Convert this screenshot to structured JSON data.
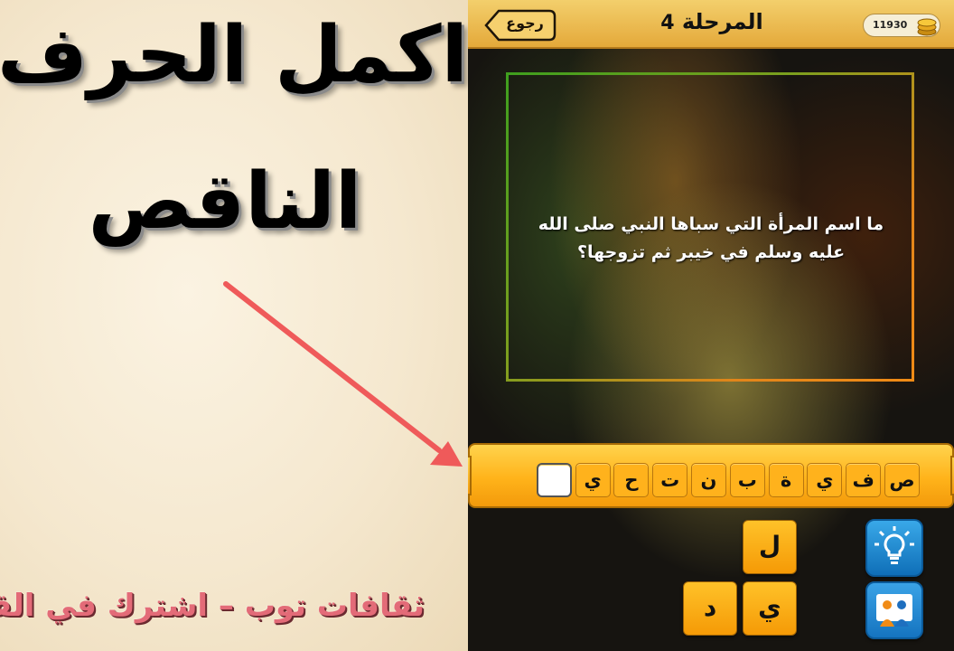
{
  "promo": {
    "title_line1": "اكمل الحرف",
    "title_line2": "الناقص",
    "footer": "ثقافات توب – اشترك في القناة"
  },
  "game": {
    "topbar": {
      "back_label": "رجوع",
      "stage_label": "المرحلة",
      "stage_number": "4",
      "coins": "11930"
    },
    "question": "ما اسم المرأة التي سباها النبي صلى الله عليه وسلم في خيبر ثم تزوجها؟",
    "answer_slots": [
      "ص",
      "ف",
      "ي",
      "ة",
      "ب",
      "ن",
      "ت",
      "ح",
      "ي",
      ""
    ],
    "letter_tiles": [
      "ل",
      "ي",
      "د"
    ],
    "icons": [
      "hint-lightbulb-icon",
      "share-people-icon",
      "coin-stack-icon",
      "back-arrow-icon"
    ],
    "colors": {
      "topbar": "#f0c45a",
      "tile": "#ffb21c",
      "frame_green": "#3f9f1e",
      "frame_orange": "#f08b16",
      "hint_blue": "#1f8ad4",
      "arrow_red": "#ef5a5a"
    }
  }
}
